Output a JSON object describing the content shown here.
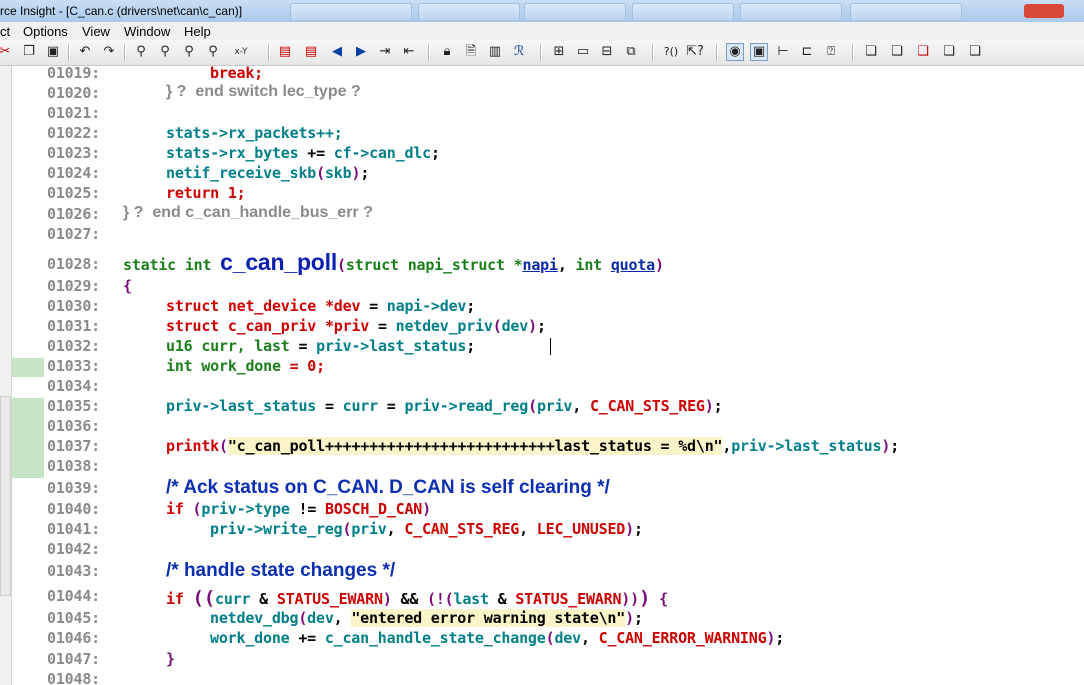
{
  "window": {
    "title": "rce Insight - [C_can.c (drivers\\net\\can\\c_can)]"
  },
  "menu": [
    "ct",
    "Options",
    "View",
    "Window",
    "Help"
  ],
  "toolbar_icons": [
    "cut-icon",
    "copy-icon",
    "paste-icon",
    "undo-icon",
    "redo-icon",
    "find-icon",
    "find-prev-icon",
    "find-next-icon",
    "replace-icon",
    "close-icon",
    "bookmark-icon",
    "bookmark-list-icon",
    "back-icon",
    "forward-icon",
    "jump-icon",
    "jump-list-icon",
    "lock-icon",
    "file-icon",
    "book-icon",
    "relation-icon",
    "layout1-icon",
    "layout2-icon",
    "layout3-icon",
    "layout4-icon",
    "symbol-icon",
    "help-cursor-icon",
    "view-toggle-icon",
    "window-icon",
    "tree-icon",
    "graph-icon",
    "info-icon",
    "project1-icon",
    "project2-icon",
    "project3-icon",
    "project4-icon",
    "project5-icon"
  ],
  "line_numbers": [
    "01019:",
    "01020:",
    "01021:",
    "01022:",
    "01023:",
    "01024:",
    "01025:",
    "01026:",
    "01027:",
    "01028:",
    "01029:",
    "01030:",
    "01031:",
    "01032:",
    "01033:",
    "01034:",
    "01035:",
    "01036:",
    "01037:",
    "01038:",
    "01039:",
    "01040:",
    "01041:",
    "01042:",
    "01043:",
    "01044:",
    "01045:",
    "01046:",
    "01047:",
    "01048:"
  ],
  "code": {
    "break": "break;",
    "end_switch": "} ?  end switch lec_type ?",
    "rx_packets": "stats->rx_packets++;",
    "rx_bytes_a": "stats->rx_bytes",
    "rx_bytes_b": " += ",
    "rx_bytes_c": "cf->can_dlc",
    "netif_a": "netif_receive_skb",
    "netif_b": "skb",
    "return_kw": "return",
    "return_val": " 1;",
    "end_fn": "} ?  end c_can_handle_bus_err ?",
    "sig_static": "static int ",
    "fn_name": "c_can_poll",
    "sig_struct": "struct napi_struct *",
    "sig_napi": "napi",
    "sig_int": " int ",
    "sig_quota": "quota",
    "open_brace": "{",
    "l1030_a": "struct net_device *dev",
    "l1030_b": " = ",
    "l1030_c": "napi->dev",
    "l1031_a": "struct c_can_priv *priv",
    "l1031_b": " = ",
    "l1031_c": "netdev_priv",
    "l1031_d": "dev",
    "l1032_a": "u16 curr, last",
    "l1032_b": " = ",
    "l1032_c": "priv->last_status",
    "l1033_a": "int work_done",
    "l1033_b": " = 0;",
    "l1035_a": "priv->last_status",
    "l1035_b": " = ",
    "l1035_c": "curr",
    "l1035_d": "priv->read_reg",
    "l1035_e": "priv",
    "l1035_f": "C_CAN_STS_REG",
    "printk": "printk",
    "printk_str": "\"c_can_poll++++++++++++++++++++++++++last_status = %d\\n\"",
    "printk_arg": "priv->last_status",
    "cmt_ack": "/* Ack status on C_CAN. D_CAN is self clearing */",
    "if_kw": "if",
    "l1040_a": "priv->type",
    "l1040_b": " != ",
    "l1040_c": "BOSCH_D_CAN",
    "l1041_a": "priv->write_reg",
    "l1041_b": "priv",
    "l1041_c": "C_CAN_STS_REG",
    "l1041_d": "LEC_UNUSED",
    "cmt_state": "/* handle state changes */",
    "l1044_a": "curr",
    "l1044_b": "STATUS_EWARN",
    "l1044_c": "last",
    "l1044_d": "STATUS_EWARN",
    "l1045_a": "netdev_dbg",
    "l1045_b": "dev",
    "l1045_c": "\"entered error warning state\\n\"",
    "l1046_a": "work_done",
    "l1046_b": " += ",
    "l1046_c": "c_can_handle_state_change",
    "l1046_d": "dev",
    "l1046_e": "C_CAN_ERROR_WARNING",
    "close_brace": "}"
  }
}
